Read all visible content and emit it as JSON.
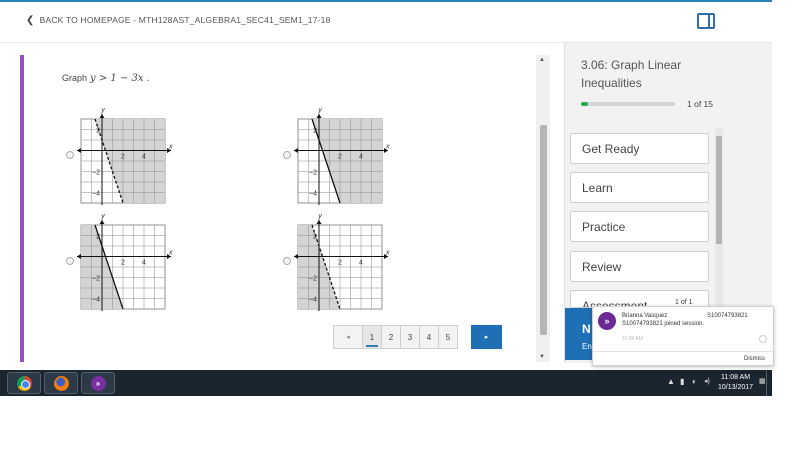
{
  "header": {
    "back_label": "BACK TO HOMEPAGE - MTH128AST_ALGEBRA1_SEC41_SEM1_17-18",
    "back_icon": "chevron-left-icon",
    "panel_icon": "sidebar-toggle-icon"
  },
  "question": {
    "prompt": "Graph",
    "inequality": "y > 1 − 3x ."
  },
  "graph_labels": {
    "x": "x",
    "y": "y",
    "pos2": "2",
    "pos4": "4",
    "neg2": "−2",
    "neg4": "−4"
  },
  "choices": [
    {
      "line": "dashed",
      "shade": "right"
    },
    {
      "line": "solid",
      "shade": "right"
    },
    {
      "line": "solid",
      "shade": "left"
    },
    {
      "line": "dashed",
      "shade": "left"
    }
  ],
  "pagination": {
    "prev": "◂",
    "pages": [
      "1",
      "2",
      "3",
      "4",
      "5"
    ],
    "current": "1",
    "next": "▸"
  },
  "sidebar": {
    "lesson_title": "3.06: Graph Linear Inequalities",
    "progress": 0.07,
    "progress_text": "1 of 15",
    "nav_items": [
      "Get Ready",
      "Learn",
      "Practice",
      "Review",
      "Assessment"
    ],
    "assessment_count": "1 of 1",
    "next_button": "N",
    "next_sub": "En"
  },
  "notification": {
    "name": "Brianna Vasquez",
    "id": "S10074793821",
    "message": "S10074793821 joined session.",
    "time": "11:08 AM",
    "dismiss": "Dismiss"
  },
  "taskbar": {
    "time": "11:08 AM",
    "date": "10/13/2017",
    "tray_icons": [
      "▲",
      "▮",
      "◐",
      "◂)",
      "▦"
    ]
  },
  "colors": {
    "accent": "#9b4fc4",
    "primary": "#1f6fb5",
    "progress": "#2fa84f",
    "shade": "#d4d4d4"
  }
}
